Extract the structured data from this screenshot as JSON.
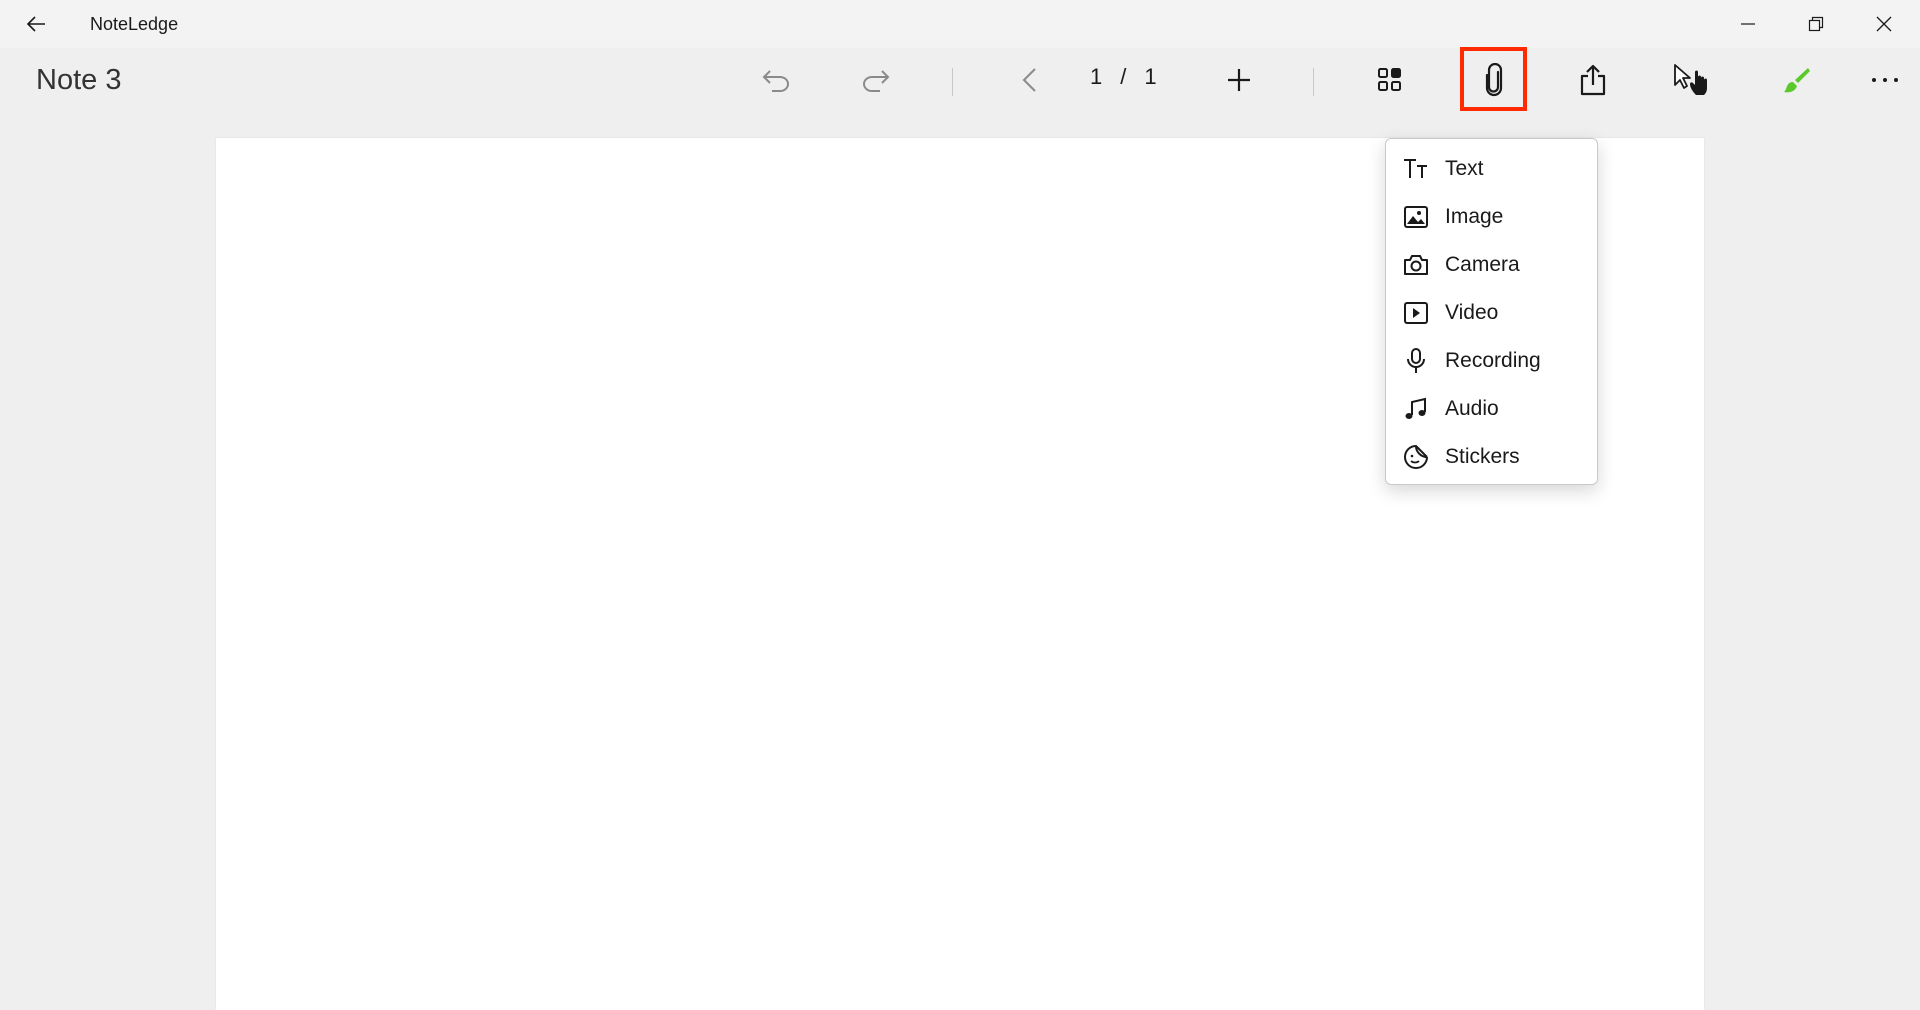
{
  "window": {
    "app_title": "NoteLedge"
  },
  "toolbar": {
    "note_title": "Note 3",
    "page_current": "1",
    "page_separator": "/",
    "page_total": "1"
  },
  "attach_menu": {
    "items": [
      {
        "label": "Text",
        "icon": "text-icon"
      },
      {
        "label": "Image",
        "icon": "image-icon"
      },
      {
        "label": "Camera",
        "icon": "camera-icon"
      },
      {
        "label": "Video",
        "icon": "video-icon"
      },
      {
        "label": "Recording",
        "icon": "microphone-icon"
      },
      {
        "label": "Audio",
        "icon": "music-note-icon"
      },
      {
        "label": "Stickers",
        "icon": "sticker-icon"
      }
    ]
  },
  "colors": {
    "highlight": "#ff2a00",
    "brush_accent": "#5cc92a",
    "background": "#efefef",
    "page": "#ffffff"
  }
}
